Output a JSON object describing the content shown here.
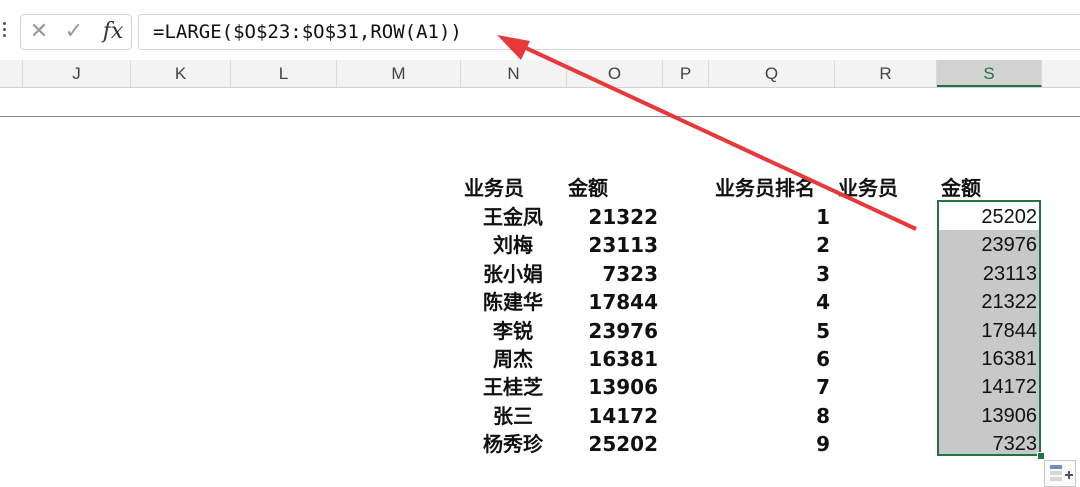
{
  "formula_bar": {
    "cancel_icon": "close-icon",
    "enter_icon": "check-icon",
    "fx_label": "fx",
    "formula": "=LARGE($O$23:$O$31,ROW(A1))"
  },
  "columns": [
    "J",
    "K",
    "L",
    "M",
    "N",
    "O",
    "P",
    "Q",
    "R",
    "S"
  ],
  "selected_column": "S",
  "headers": {
    "salesperson": "业务员",
    "amount": "金额",
    "rank": "业务员排名",
    "salesperson2": "业务员",
    "amount2": "金额"
  },
  "rows": [
    {
      "name": "王金凤",
      "amount": "21322",
      "rank": "1",
      "result": "25202"
    },
    {
      "name": "刘梅",
      "amount": "23113",
      "rank": "2",
      "result": "23976"
    },
    {
      "name": "张小娟",
      "amount": "7323",
      "rank": "3",
      "result": "23113"
    },
    {
      "name": "陈建华",
      "amount": "17844",
      "rank": "4",
      "result": "21322"
    },
    {
      "name": "李锐",
      "amount": "23976",
      "rank": "5",
      "result": "17844"
    },
    {
      "name": "周杰",
      "amount": "16381",
      "rank": "6",
      "result": "16381"
    },
    {
      "name": "王桂芝",
      "amount": "13906",
      "rank": "7",
      "result": "14172"
    },
    {
      "name": "张三",
      "amount": "14172",
      "rank": "8",
      "result": "13906"
    },
    {
      "name": "杨秀珍",
      "amount": "25202",
      "rank": "9",
      "result": "7323"
    }
  ],
  "colors": {
    "accent": "#217346",
    "arrow": "#e8383a"
  }
}
